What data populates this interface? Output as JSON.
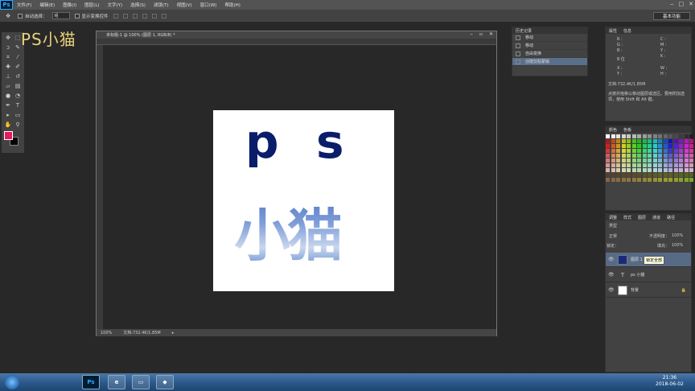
{
  "app": {
    "logo": "Ps",
    "workspace": "基本功能"
  },
  "menu": [
    "文件(F)",
    "编辑(E)",
    "图像(I)",
    "图层(L)",
    "文字(Y)",
    "选择(S)",
    "滤镜(T)",
    "视图(V)",
    "窗口(W)",
    "帮助(H)"
  ],
  "options": {
    "auto_select_label": "自动选择：",
    "auto_select_value": "组",
    "show_transform_label": "显示变换控件"
  },
  "watermark": "PS小猫",
  "document": {
    "tab_title": "未标题-1 @ 100% (图层 1, RGB/8) *",
    "zoom": "100%",
    "doc_info": "文档:732.4K/1.85M"
  },
  "canvas_text": {
    "p": "p",
    "s": "s",
    "cat": "小猫"
  },
  "history": {
    "tabs": [
      "历史记录"
    ],
    "items": [
      "移动",
      "移动",
      "自由变换",
      "创建剪贴蒙版"
    ]
  },
  "info": {
    "tabs": [
      "属性",
      "信息"
    ],
    "r": "R :",
    "g": "G :",
    "b": "B :",
    "bit": "8 位",
    "c": "C :",
    "m": "M :",
    "y": "Y :",
    "k": "K :",
    "x": "X :",
    "yy": "Y :",
    "w": "W :",
    "h": "H :",
    "doc": "文档:732.4K/1.85M",
    "hint": "点按并拖移以移动图层或选区。要用附加选项，使用 Shift 和 Alt 键。"
  },
  "swatch_tabs": [
    "颜色",
    "色板"
  ],
  "layers": {
    "tabs": [
      "调整",
      "样式",
      "图层",
      "通道",
      "路径"
    ],
    "kind": "类型",
    "blend": "正常",
    "opacity_label": "不透明度：",
    "opacity": "100%",
    "lock_label": "锁定：",
    "fill_label": "填充：",
    "fill": "100%",
    "rows": [
      {
        "name": "图层 1"
      },
      {
        "name": "ps 小猫"
      },
      {
        "name": "背景"
      }
    ],
    "tooltip": "锁定全部"
  },
  "taskbar": {
    "ps": "Ps",
    "time": "21:36",
    "date": "2018-06-02"
  },
  "colors": {
    "foreground": "#e8185b",
    "background": "#000000"
  }
}
